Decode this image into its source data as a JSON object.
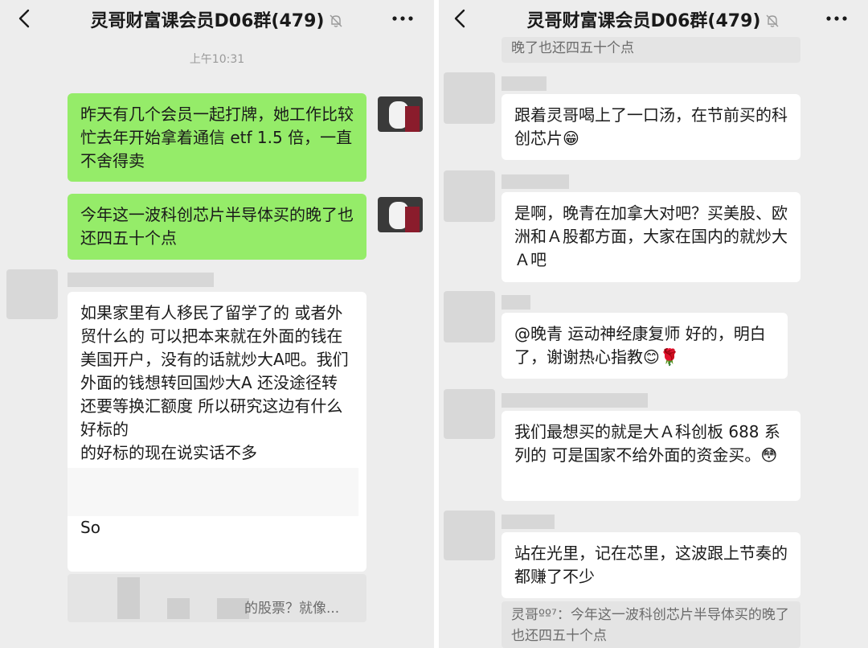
{
  "left": {
    "title": "灵哥财富课会员D06群(479)",
    "timestamp": "上午10:31",
    "messages": [
      {
        "text": "昨天有几个会员一起打牌，她工作比较忙去年开始拿着通信 etf 1.5 倍，一直不舍得卖"
      },
      {
        "text": "今年这一波科创芯片半导体买的晚了也还四五十个点"
      },
      {
        "text": "如果家里有人移民了留学了的 或者外贸什么的 可以把本来就在外面的钱在美国开户，没有的话就炒大A吧。我们外面的钱想转回国炒大A 还没途径转 还要等换汇额度 所以研究这边有什么好标的"
      },
      {
        "text": "的好标的现在说实话不多"
      },
      {
        "text": "So"
      }
    ],
    "quote_tail": "的股票？就像..."
  },
  "right": {
    "title": "灵哥财富课会员D06群(479)",
    "top_quote": "晚了也还四五十个点",
    "messages": [
      {
        "text": "跟着灵哥喝上了一口汤，在节前买的科创芯片😁"
      },
      {
        "text": "是啊，晚青在加拿大对吧？买美股、欧洲和Ａ股都方面，大家在国内的就炒大Ａ吧"
      },
      {
        "text": "@晚青 运动神经康复师  好的，明白了，谢谢热心指教😊🌹"
      },
      {
        "text": "我们最想买的就是大Ａ科创板 688 系列的 可是国家不给外面的资金买。😳"
      },
      {
        "text": "站在光里，记在芯里，这波跟上节奏的都赚了不少"
      }
    ],
    "bottom_quote": "灵哥ºº⁷：今年这一波科创芯片半导体买的晚了也还四五十个点"
  },
  "icons": {
    "back": "chevron-left-icon",
    "mute": "bell-mute-icon",
    "more": "more-dots-icon"
  },
  "colors": {
    "chat_bg": "#ededed",
    "sent_bubble": "#95ec69",
    "received_bubble": "#ffffff"
  }
}
